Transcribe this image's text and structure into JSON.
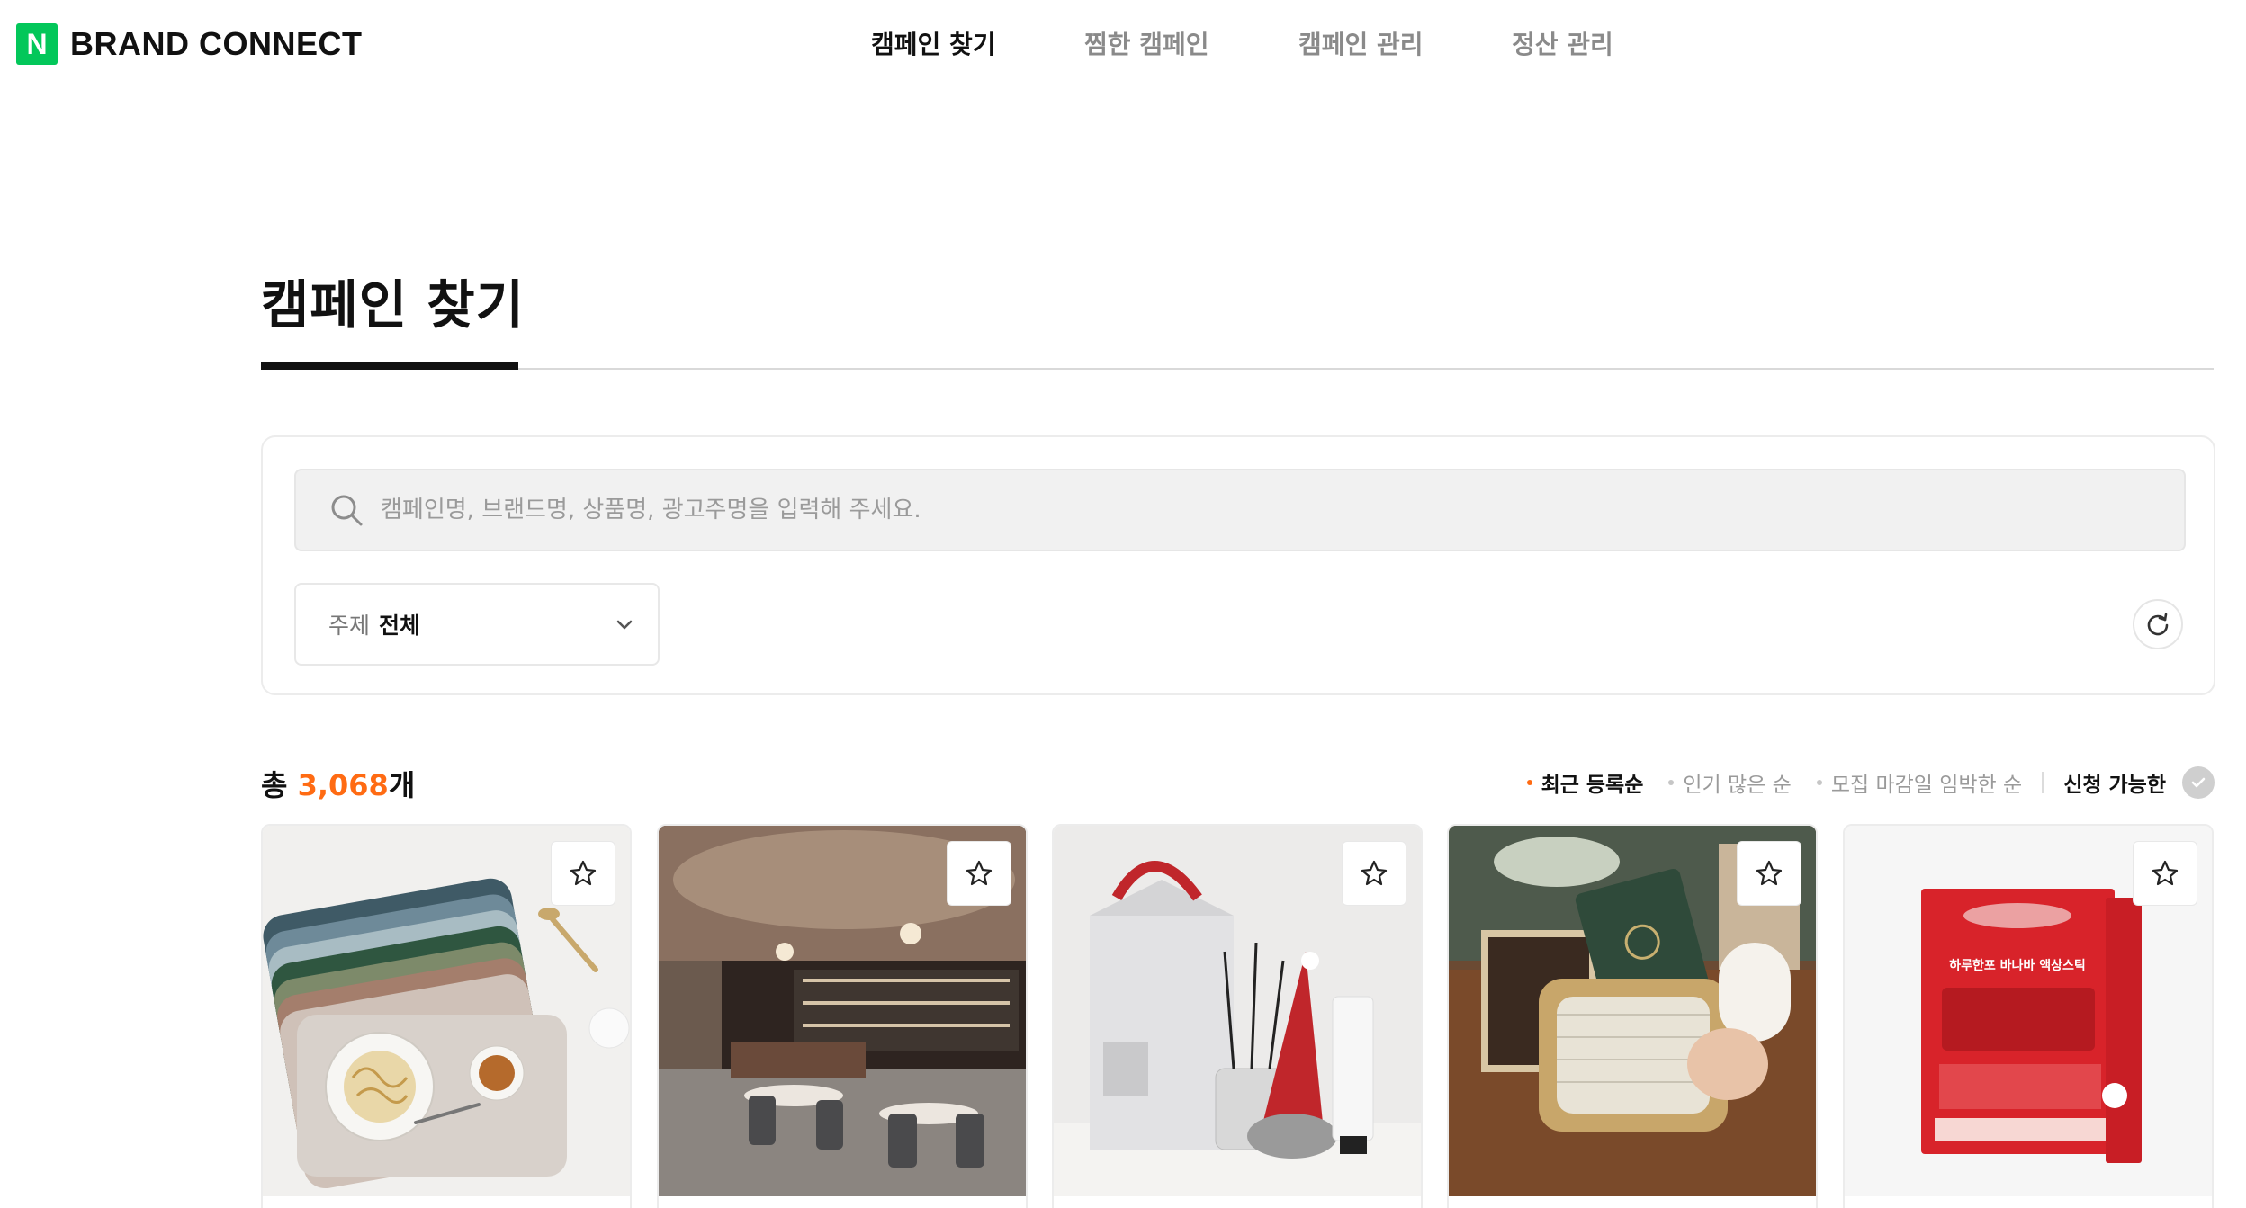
{
  "brand": {
    "badge": "N",
    "name": "BRAND CONNECT"
  },
  "nav": {
    "items": [
      {
        "label": "캠페인 찾기",
        "active": true
      },
      {
        "label": "찜한 캠페인",
        "active": false
      },
      {
        "label": "캠페인 관리",
        "active": false
      },
      {
        "label": "정산 관리",
        "active": false
      }
    ]
  },
  "page": {
    "title": "캠페인 찾기"
  },
  "search": {
    "placeholder": "캠페인명, 브랜드명, 상품명, 광고주명을 입력해 주세요.",
    "value": ""
  },
  "filter": {
    "label": "주제",
    "value": "전체"
  },
  "results": {
    "prefix": "총 ",
    "count": "3,068",
    "suffix": "개"
  },
  "sort": {
    "options": [
      {
        "label": "최근 등록순",
        "active": true
      },
      {
        "label": "인기 많은 순",
        "active": false
      },
      {
        "label": "모집 마감일 임박한 순",
        "active": false
      }
    ],
    "available_label": "신청 가능한"
  },
  "colors": {
    "brand": "#03c75a",
    "accent": "#ff6b13"
  },
  "cards": [
    {
      "image": "placemat-product-image"
    },
    {
      "image": "restaurant-interior-image"
    },
    {
      "image": "diffuser-gift-set-image"
    },
    {
      "image": "travel-pouch-image"
    },
    {
      "image": "banaba-stick-package-image",
      "image_text": "하루한포 바나바 액상스틱"
    }
  ]
}
